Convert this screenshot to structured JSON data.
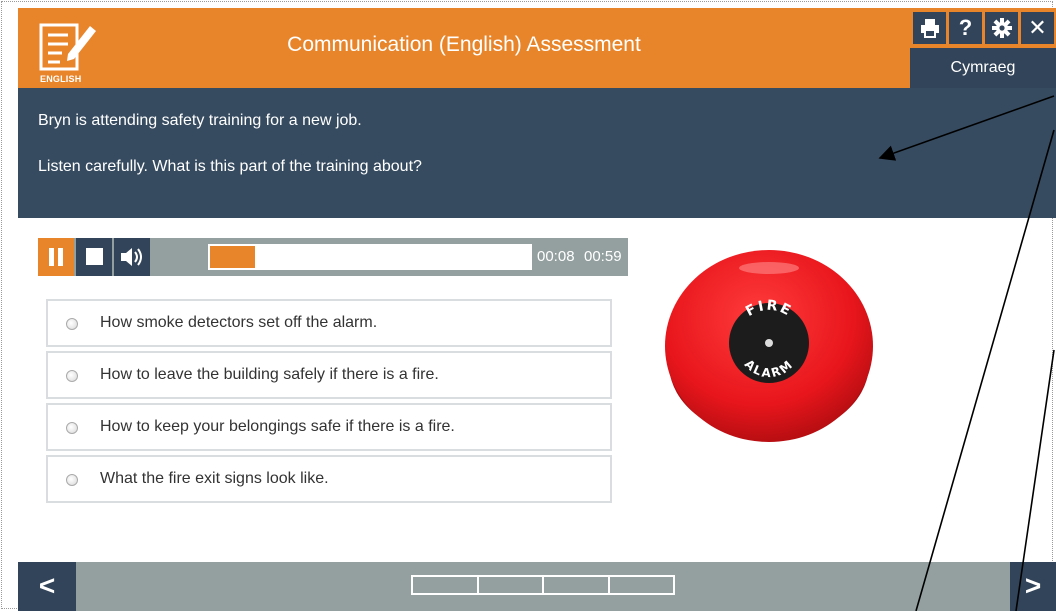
{
  "header": {
    "logo_label": "ENGLISH",
    "title": "Communication (English) Assessment",
    "tools": {
      "print_icon": "printer-icon",
      "help": "?",
      "settings_icon": "gear-icon",
      "close": "✕"
    },
    "language_toggle": "Cymraeg"
  },
  "question": {
    "line1": "Bryn is attending safety training for a new job.",
    "line2": "Listen carefully. What is this part of the training about?"
  },
  "player": {
    "elapsed": "00:08",
    "duration": "00:59",
    "progress_fraction": 0.14
  },
  "options": [
    {
      "label": "How smoke detectors set off the alarm."
    },
    {
      "label": "How to leave the building safely if there is a fire."
    },
    {
      "label": "How to keep your belongings safe if there is a fire."
    },
    {
      "label": "What the fire exit signs look like."
    }
  ],
  "image": {
    "badge_top": "FIRE",
    "badge_bottom": "ALARM"
  },
  "footer": {
    "prev": "<",
    "next": ">",
    "progress_segments": 4
  },
  "colors": {
    "accent": "#e8852b",
    "navy": "#364b60",
    "dark_navy": "#324459",
    "grey": "#93a09f",
    "alarm_red": "#e8161c"
  }
}
